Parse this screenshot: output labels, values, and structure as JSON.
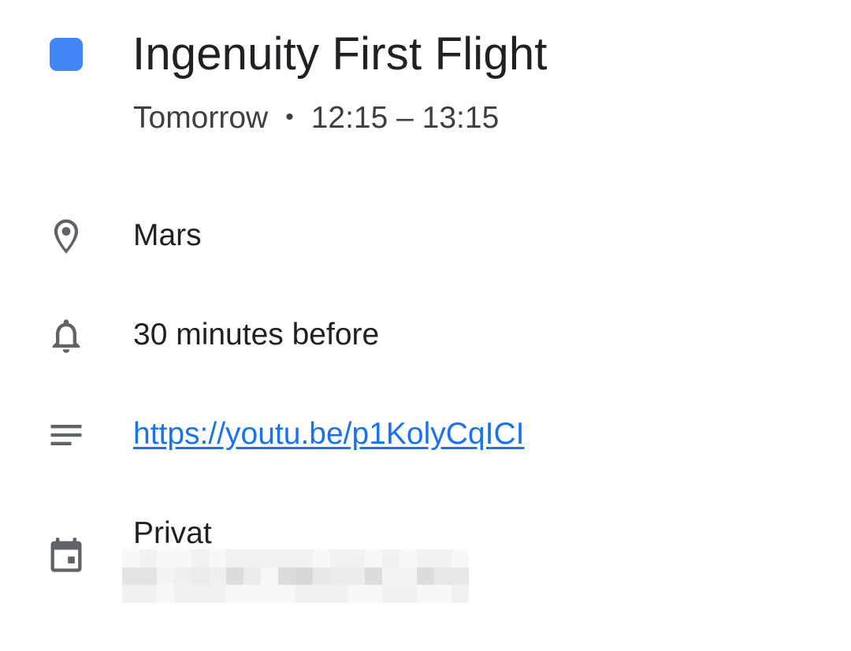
{
  "event": {
    "color": "#4285f4",
    "title": "Ingenuity First Flight",
    "day": "Tomorrow",
    "separator": "•",
    "time_range": "12:15 – 13:15"
  },
  "details": {
    "location": {
      "icon": "location-pin-icon",
      "text": "Mars"
    },
    "reminder": {
      "icon": "bell-icon",
      "text": "30 minutes before"
    },
    "description": {
      "icon": "notes-icon",
      "text": "https://youtu.be/p1KolyCqICI"
    },
    "calendar": {
      "icon": "calendar-icon",
      "name": "Privat",
      "account_redacted": true
    }
  },
  "colors": {
    "icon_gray": "#5f6368",
    "link_blue": "#1a73e8",
    "text_primary": "#202124"
  }
}
